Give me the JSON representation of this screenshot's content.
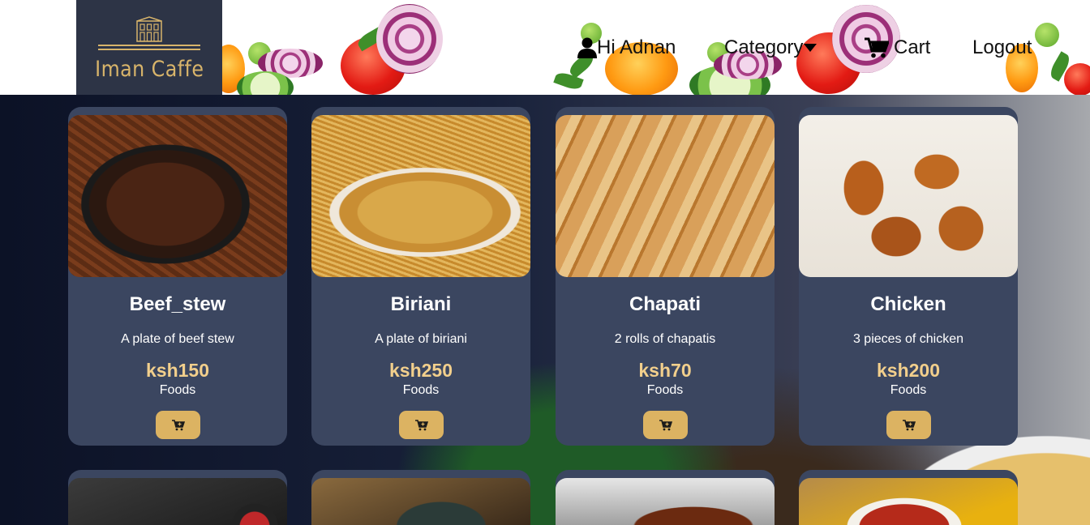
{
  "brand": {
    "name": "Iman Caffe"
  },
  "nav": {
    "greeting": "Hi Adnan",
    "category": "Category",
    "cart": "Cart",
    "logout": "Logout"
  },
  "products": [
    {
      "name": "Beef_stew",
      "description": "A plate of beef stew",
      "price": "ksh150",
      "category": "Foods"
    },
    {
      "name": "Biriani",
      "description": "A plate of biriani",
      "price": "ksh250",
      "category": "Foods"
    },
    {
      "name": "Chapati",
      "description": "2 rolls of chapatis",
      "price": "ksh70",
      "category": "Foods"
    },
    {
      "name": "Chicken",
      "description": "3 pieces of chicken",
      "price": "ksh200",
      "category": "Foods"
    }
  ],
  "colors": {
    "header_bg": "#ffffff",
    "logo_bg": "#2d3446",
    "logo_gold": "#d8b46a",
    "card_bg": "#3b4660",
    "price": "#f2cf8c",
    "cart_button": "#dcb362"
  },
  "icons": {
    "user": "user-icon",
    "category": "caret-down-icon",
    "cart": "shopping-cart-icon",
    "add_to_cart": "add-to-cart-icon"
  }
}
